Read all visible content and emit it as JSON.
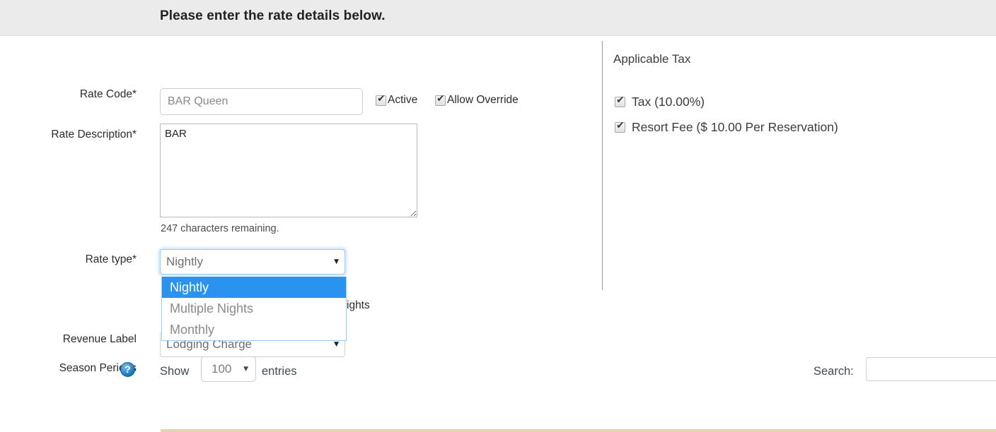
{
  "header": {
    "title": "Please enter the rate details below."
  },
  "form": {
    "rate_code": {
      "label": "Rate Code*",
      "value": "BAR Queen",
      "placeholder": "BAR Queen"
    },
    "rate_description": {
      "label": "Rate Description*",
      "value": "BAR",
      "characters_remaining": "247 characters remaining."
    },
    "checkboxes": [
      {
        "name": "active",
        "label": "Active",
        "checked": true
      },
      {
        "name": "allow-override",
        "label": "Allow Override",
        "checked": true
      }
    ],
    "rate_type": {
      "label": "Rate type*",
      "selected": "Nightly",
      "expanded": true,
      "options": [
        {
          "label": "Nightly",
          "highlighted": true
        },
        {
          "label": "Multiple Nights",
          "highlighted": false
        },
        {
          "label": "Monthly",
          "highlighted": false
        }
      ]
    },
    "obscured_text_suffix": "ights",
    "revenue_label": {
      "label": "Revenue Label",
      "selected": "Lodging Charge"
    }
  },
  "applicable_tax": {
    "heading": "Applicable Tax",
    "items": [
      {
        "label": "Tax (10.00%)",
        "checked": true
      },
      {
        "label": "Resort Fee ($ 10.00 Per Reservation)",
        "checked": true
      }
    ]
  },
  "season_periods": {
    "label": "Season Periods",
    "help_icon": "question-mark-icon",
    "help_glyph": "?",
    "show_text": "Show",
    "entries_value": "100",
    "entries_text": "entries",
    "search_label": "Search:",
    "search_value": "",
    "search_placeholder": ""
  },
  "icons": {
    "dropdown_arrow": "▼",
    "checkmark": "✔"
  },
  "colors": {
    "header_bg": "#ebebeb",
    "option_highlight": "#2a93f0",
    "focus_border": "#9ecaf0",
    "table_rule": "#e7d4ae",
    "help_icon": "#1f7fc4"
  }
}
